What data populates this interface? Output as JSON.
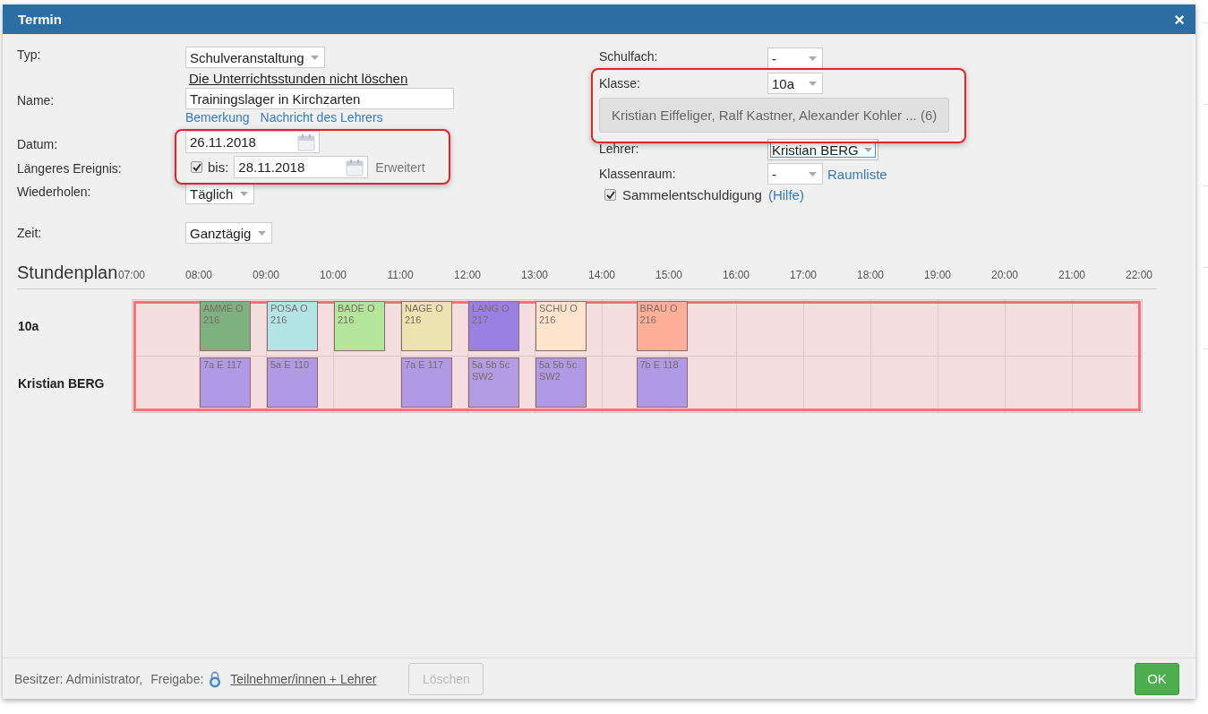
{
  "dialog": {
    "title": "Termin",
    "close": "×"
  },
  "left_form": {
    "typ": {
      "label": "Typ:",
      "value": "Schulveranstaltung",
      "link": "Die Unterrichtsstunden nicht löschen"
    },
    "name": {
      "label": "Name:",
      "value": "Trainingslager in Kirchzarten",
      "links": [
        "Bemerkung",
        "Nachricht des Lehrers"
      ]
    },
    "datum": {
      "label": "Datum:",
      "value": "26.11.2018"
    },
    "longer": {
      "label": "Längeres Ereignis:",
      "checked": true,
      "until_label": "bis:",
      "until_value": "28.11.2018",
      "extended": "Erweitert"
    },
    "repeat": {
      "label": "Wiederholen:",
      "value": "Täglich"
    },
    "time": {
      "label": "Zeit:",
      "value": "Ganztägig"
    }
  },
  "right_form": {
    "subject": {
      "label": "Schulfach:",
      "value": "-"
    },
    "class": {
      "label": "Klasse:",
      "value": "10a",
      "students": "Kristian Eiffeliger, Ralf Kastner, Alexander Kohler ... (6)"
    },
    "teacher": {
      "label": "Lehrer:",
      "value": "Kristian BERG",
      "focused": true
    },
    "room": {
      "label": "Klassenraum:",
      "value": "-",
      "link": "Raumliste"
    },
    "excuse": {
      "label": "Sammelentschuldigung",
      "checked": true,
      "link": "(Hilfe)"
    }
  },
  "timetable": {
    "title": "Stundenplan",
    "hours": [
      "07:00",
      "08:00",
      "09:00",
      "10:00",
      "11:00",
      "12:00",
      "13:00",
      "14:00",
      "15:00",
      "16:00",
      "17:00",
      "18:00",
      "19:00",
      "20:00",
      "21:00",
      "22:00"
    ],
    "rows": [
      {
        "label": "10a",
        "slots": [
          {
            "kind": "empty"
          },
          {
            "kind": "lesson",
            "text": "AMME O 216",
            "color": "#7fb07f"
          },
          {
            "kind": "lesson",
            "text": "POSA O 216",
            "color": "#b3e5e6"
          },
          {
            "kind": "lesson",
            "text": "BADE O 216",
            "color": "#b3e69a"
          },
          {
            "kind": "lesson",
            "text": "NAGE O 216",
            "color": "#ede3b0"
          },
          {
            "kind": "lesson",
            "text": "LANG O 217",
            "color": "#9b80e4"
          },
          {
            "kind": "lesson",
            "text": "SCHU O 216",
            "color": "#fee4cc"
          },
          {
            "kind": "half_past",
            "text": "BRAU O 216",
            "color": "#ffae98"
          }
        ]
      },
      {
        "label": "Kristian BERG",
        "slots": [
          {
            "kind": "empty"
          },
          {
            "kind": "lesson",
            "text": "7a E 117",
            "color": "#b09ae6"
          },
          {
            "kind": "lesson",
            "text": "5a E 110",
            "color": "#b09ae6"
          },
          {
            "kind": "empty"
          },
          {
            "kind": "lesson",
            "text": "7a E 117",
            "color": "#b09ae6"
          },
          {
            "kind": "lesson",
            "text": "5a 5b 5c SW2",
            "color": "#b39ce4"
          },
          {
            "kind": "lesson",
            "text": "5a 5b 5c SW2",
            "color": "#b09ae6"
          },
          {
            "kind": "half_past",
            "text": "7b E 118",
            "color": "#b09ae6"
          }
        ]
      }
    ]
  },
  "footer": {
    "owner": "Besitzer: Administrator,",
    "share_label": "Freigabe:",
    "share_link": "Teilnehmer/innen + Lehrer",
    "delete": {
      "label": "Löschen",
      "disabled": true
    },
    "ok": "OK"
  }
}
